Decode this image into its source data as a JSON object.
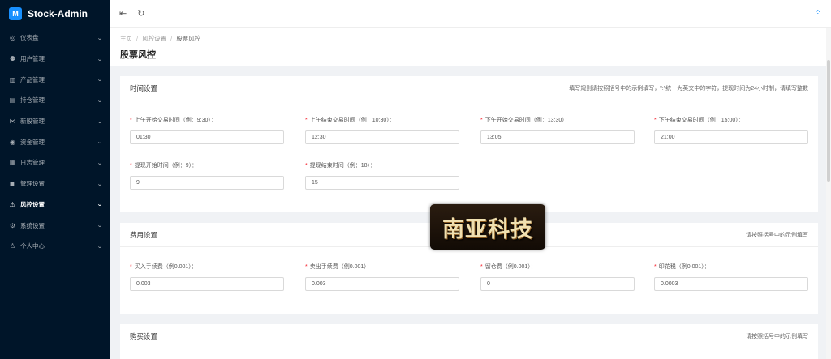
{
  "app": {
    "title": "Stock-Admin",
    "logo_text": "M"
  },
  "sidebar": {
    "items": [
      {
        "label": "仪表盘",
        "icon": "dashboard-icon",
        "glyph": "◎"
      },
      {
        "label": "用户管理",
        "icon": "users-icon",
        "glyph": "⚉"
      },
      {
        "label": "产品管理",
        "icon": "chart-icon",
        "glyph": "▥"
      },
      {
        "label": "持仓管理",
        "icon": "position-icon",
        "glyph": "▤"
      },
      {
        "label": "新股管理",
        "icon": "ipo-icon",
        "glyph": "⋈"
      },
      {
        "label": "资金管理",
        "icon": "money-icon",
        "glyph": "◉"
      },
      {
        "label": "日志管理",
        "icon": "log-icon",
        "glyph": "▦"
      },
      {
        "label": "管理设置",
        "icon": "admin-settings-icon",
        "glyph": "▣"
      },
      {
        "label": "风控设置",
        "icon": "warning-icon",
        "glyph": "⚠",
        "active": true
      },
      {
        "label": "系统设置",
        "icon": "gear-icon",
        "glyph": "⚙"
      },
      {
        "label": "个人中心",
        "icon": "user-icon",
        "glyph": "♙"
      }
    ]
  },
  "topbar": {
    "collapse_icon": "menu-fold-icon",
    "refresh_icon": "refresh-icon",
    "loading_icon": "spinner-icon"
  },
  "breadcrumb": {
    "home": "主页",
    "parent": "风控设置",
    "current": "股票风控"
  },
  "page_title": "股票风控",
  "sections": {
    "time": {
      "title": "时间设置",
      "hint": "填写规则请按照括号中的示例填写，\":\"统一为英文中的字符，提现时间为24小时制，请填写整数",
      "fields": [
        {
          "label": "上午开始交易时间（例：9:30）：",
          "value": "01:30"
        },
        {
          "label": "上午结束交易时间（例：10:30）：",
          "value": "12:30"
        },
        {
          "label": "下午开始交易时间（例：13:30）：",
          "value": "13:05"
        },
        {
          "label": "下午结束交易时间（例：15:00）：",
          "value": "21:00"
        },
        {
          "label": "提现开始时间（例：9）：",
          "value": "9"
        },
        {
          "label": "提现结束时间（例：18）：",
          "value": "15"
        }
      ]
    },
    "fee": {
      "title": "费用设置",
      "hint": "请按照括号中的示例填写",
      "fields": [
        {
          "label": "买入手续费（例0.001）：",
          "value": "0.003"
        },
        {
          "label": "卖出手续费（例0.001）：",
          "value": "0.003"
        },
        {
          "label": "留仓费（例0.001）：",
          "value": "0"
        },
        {
          "label": "印花税（例0.001）：",
          "value": "0.0003"
        }
      ]
    },
    "buy": {
      "title": "购买设置",
      "hint": "请按照括号中的示例填写"
    }
  },
  "watermark": "南亚科技",
  "colors": {
    "sidebar_bg": "#001529",
    "primary": "#1890ff",
    "required": "#f5222d"
  }
}
